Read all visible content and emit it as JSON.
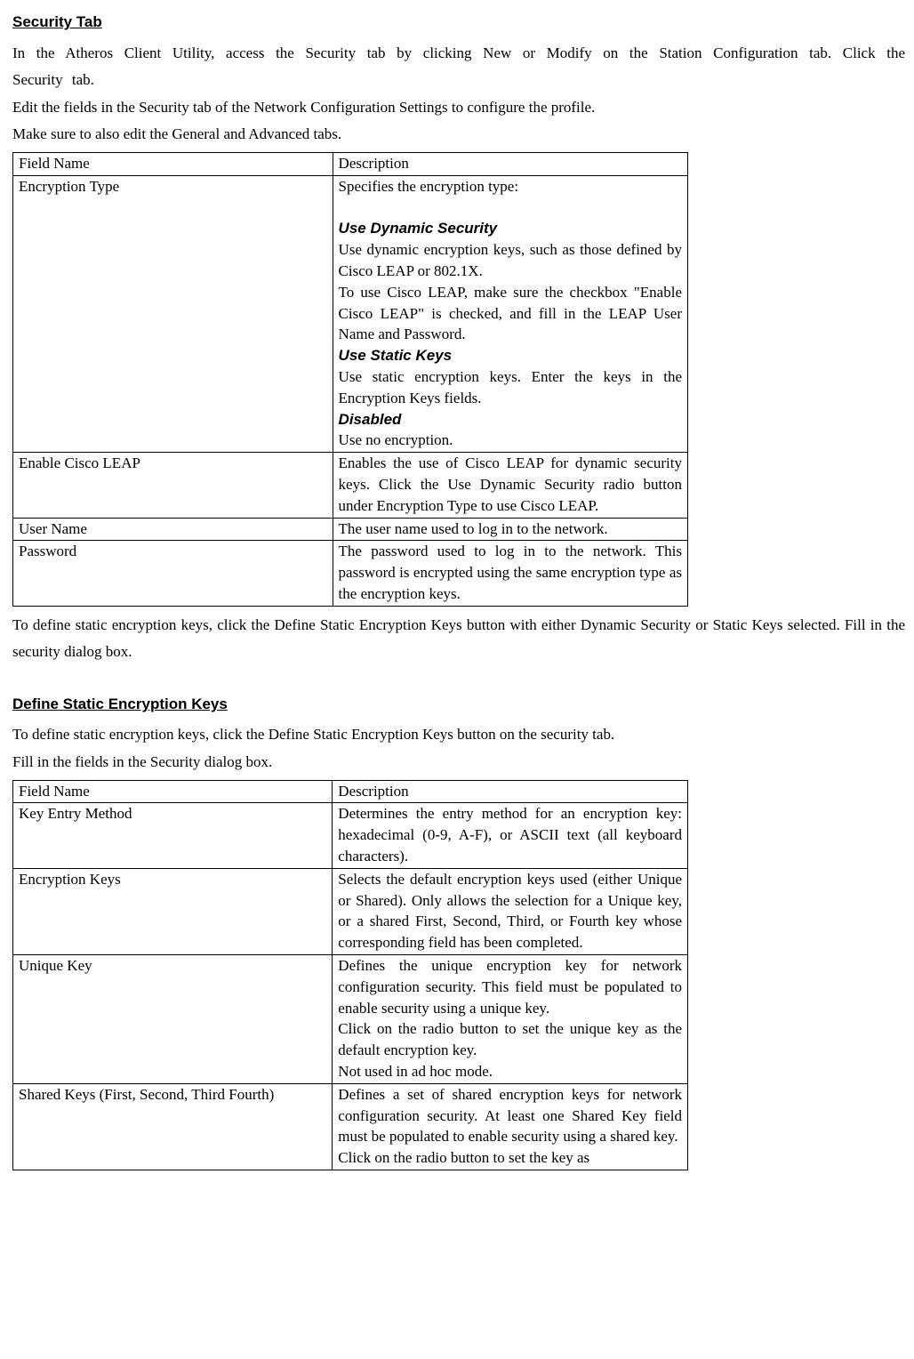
{
  "h1": "Security Tab",
  "p1": "In the Atheros Client Utility, access the Security tab by clicking New or Modify on the Station Configuration tab.   Click the Security tab.",
  "p2": "Edit the fields in the Security   tab of the Network Configuration Settings to configure the profile.",
  "p3": "Make sure to also edit the General and Advanced tabs.",
  "t1": {
    "hdr": {
      "c1": "Field Name",
      "c2": "Description"
    },
    "r1": {
      "c1": "Encryption Type",
      "c2a": "Specifies the encryption type:",
      "c2b_label": "Use Dynamic Security",
      "c2b": "Use dynamic encryption keys, such as those defined by Cisco LEAP or 802.1X.",
      "c2c": "To use Cisco LEAP, make sure the checkbox \"Enable Cisco LEAP\" is checked, and fill in the LEAP User Name and Password.",
      "c2d_label": "Use Static Keys",
      "c2d": "Use static encryption keys. Enter the keys in the Encryption Keys fields.",
      "c2e_label": "Disabled",
      "c2e": "Use no encryption."
    },
    "r2": {
      "c1": "Enable Cisco LEAP",
      "c2": "Enables the use of Cisco LEAP for dynamic security keys.  Click the Use Dynamic Security radio button under Encryption Type to use Cisco LEAP."
    },
    "r3": {
      "c1": "User Name",
      "c2": "The user name used to log in to the network."
    },
    "r4": {
      "c1": "Password",
      "c2": "The password used to log in to the network.  This password is encrypted using the same encryption type as the encryption keys."
    }
  },
  "p4": "To define static encryption keys, click the Define Static Encryption Keys button with either Dynamic Security or Static Keys selected.   Fill in the security dialog box.",
  "h2": "Define Static Encryption Keys",
  "p5": "To define static encryption keys, click the Define Static Encryption Keys button on the security tab.",
  "p6": "Fill in the fields in the Security dialog box.",
  "t2": {
    "hdr": {
      "c1": "Field Name",
      "c2": "Description"
    },
    "r1": {
      "c1": "Key Entry Method",
      "c2": "Determines the entry method for an encryption key: hexadecimal (0-9, A-F), or ASCII text (all keyboard characters)."
    },
    "r2": {
      "c1": "Encryption Keys",
      "c2": "Selects the default encryption keys used (either Unique or Shared). Only allows the selection for a Unique key, or a shared First, Second, Third, or Fourth key whose corresponding field has been completed."
    },
    "r3": {
      "c1": "Unique Key",
      "c2a": "Defines the unique encryption key for network configuration security. This field must be populated to enable security using a unique key.",
      "c2b": "Click on the radio button to set the unique key as the default encryption key.",
      "c2c": "Not used in ad hoc mode."
    },
    "r4": {
      "c1": "Shared Keys (First, Second, Third Fourth)",
      "c2a": "Defines a set of shared encryption keys for network configuration security. At least one Shared Key field must be populated to enable security using a shared key.",
      "c2b": "Click on the radio button to set the key as"
    }
  }
}
